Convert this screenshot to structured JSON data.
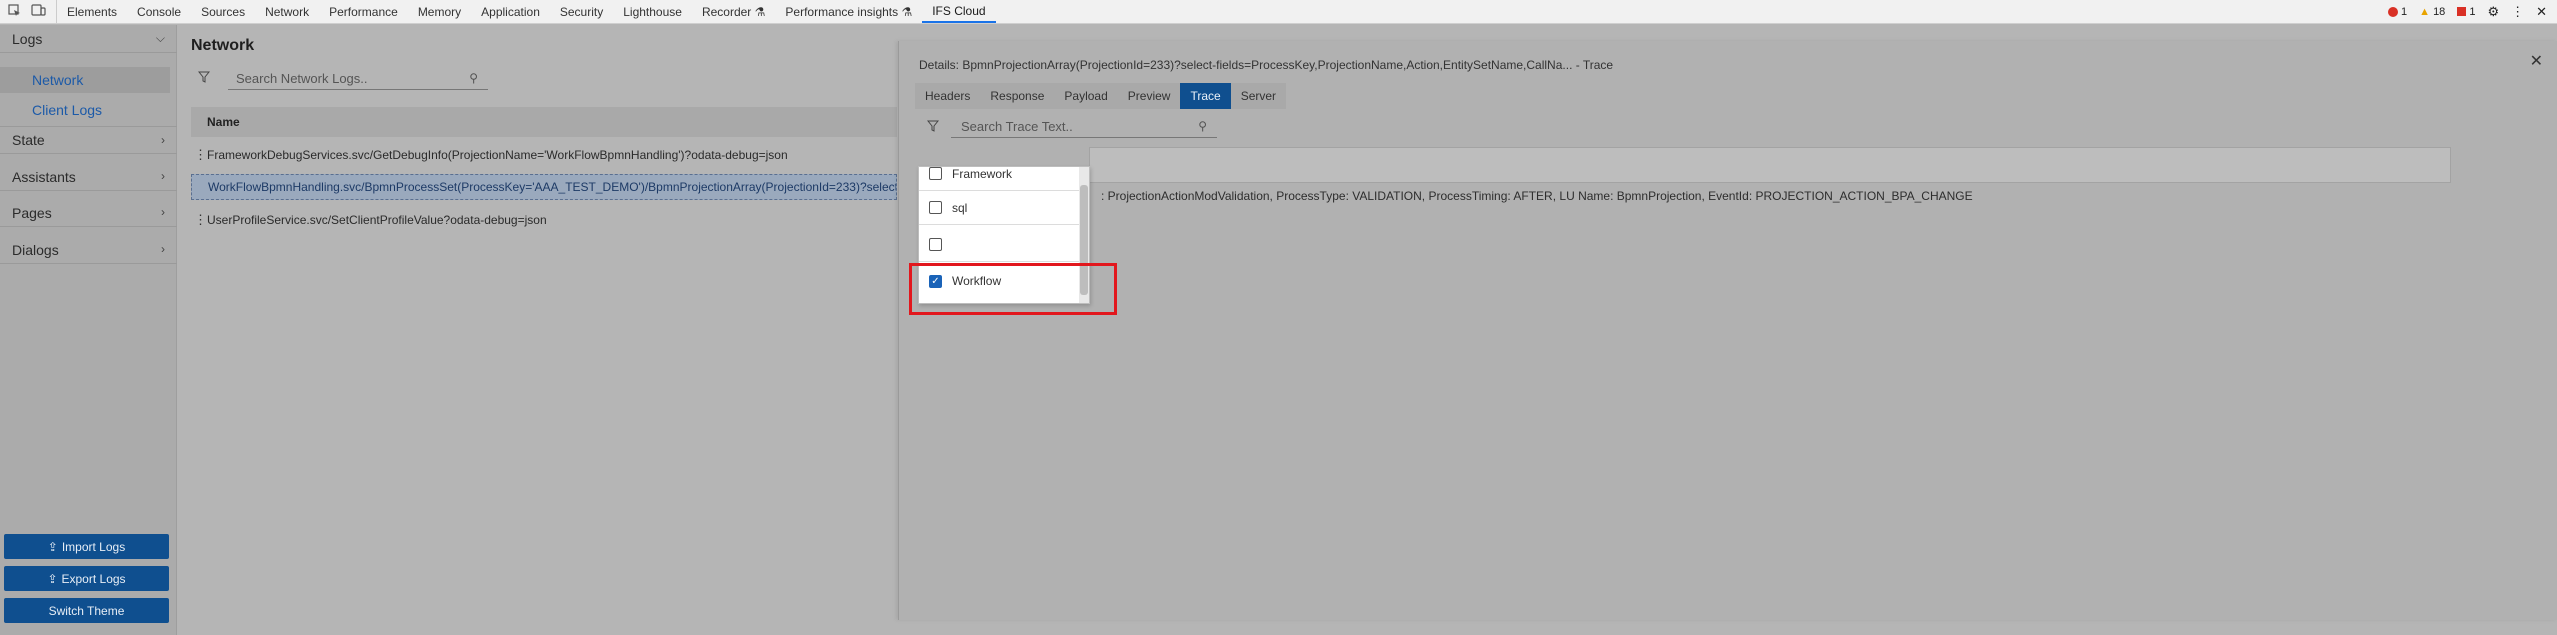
{
  "devtools": {
    "tabs": [
      "Elements",
      "Console",
      "Sources",
      "Network",
      "Performance",
      "Memory",
      "Application",
      "Security",
      "Lighthouse",
      "Recorder ⚗",
      "Performance insights ⚗",
      "IFS Cloud"
    ],
    "active_tab": "IFS Cloud",
    "errors": "1",
    "warnings": "18",
    "issues": "1"
  },
  "sidebar": {
    "logs": "Logs",
    "network": "Network",
    "client_logs": "Client Logs",
    "state": "State",
    "assistants": "Assistants",
    "pages": "Pages",
    "dialogs": "Dialogs",
    "import_logs": "Import Logs",
    "export_logs": "Export Logs",
    "switch_theme": "Switch Theme"
  },
  "main": {
    "title": "Network",
    "search_placeholder": "Search Network Logs..",
    "column_name": "Name",
    "rows": [
      "FrameworkDebugServices.svc/GetDebugInfo(ProjectionName='WorkFlowBpmnHandling')?odata-debug=json",
      "WorkFlowBpmnHandling.svc/BpmnProcessSet(ProcessKey='AAA_TEST_DEMO')/BpmnProjectionArray(ProjectionId=233)?select-fields...",
      "UserProfileService.svc/SetClientProfileValue?odata-debug=json"
    ]
  },
  "details": {
    "title": "Details: BpmnProjectionArray(ProjectionId=233)?select-fields=ProcessKey,ProjectionName,Action,EntitySetName,CallNa...  - Trace",
    "tabs": [
      "Headers",
      "Response",
      "Payload",
      "Preview",
      "Trace",
      "Server"
    ],
    "active_tab": "Trace",
    "trace_search_placeholder": "Search Trace Text..",
    "trace_line": ": ProjectionActionModValidation, ProcessType: VALIDATION, ProcessTiming: AFTER, LU Name: BpmnProjection, EventId: PROJECTION_ACTION_BPA_CHANGE"
  },
  "dropdown": {
    "options": [
      {
        "label": "Framework",
        "checked": false
      },
      {
        "label": "sql",
        "checked": false
      },
      {
        "label": "",
        "checked": false
      },
      {
        "label": "Workflow",
        "checked": true
      }
    ]
  },
  "colors": {
    "accent": "#0f4f8f",
    "highlight": "#e2171d"
  }
}
